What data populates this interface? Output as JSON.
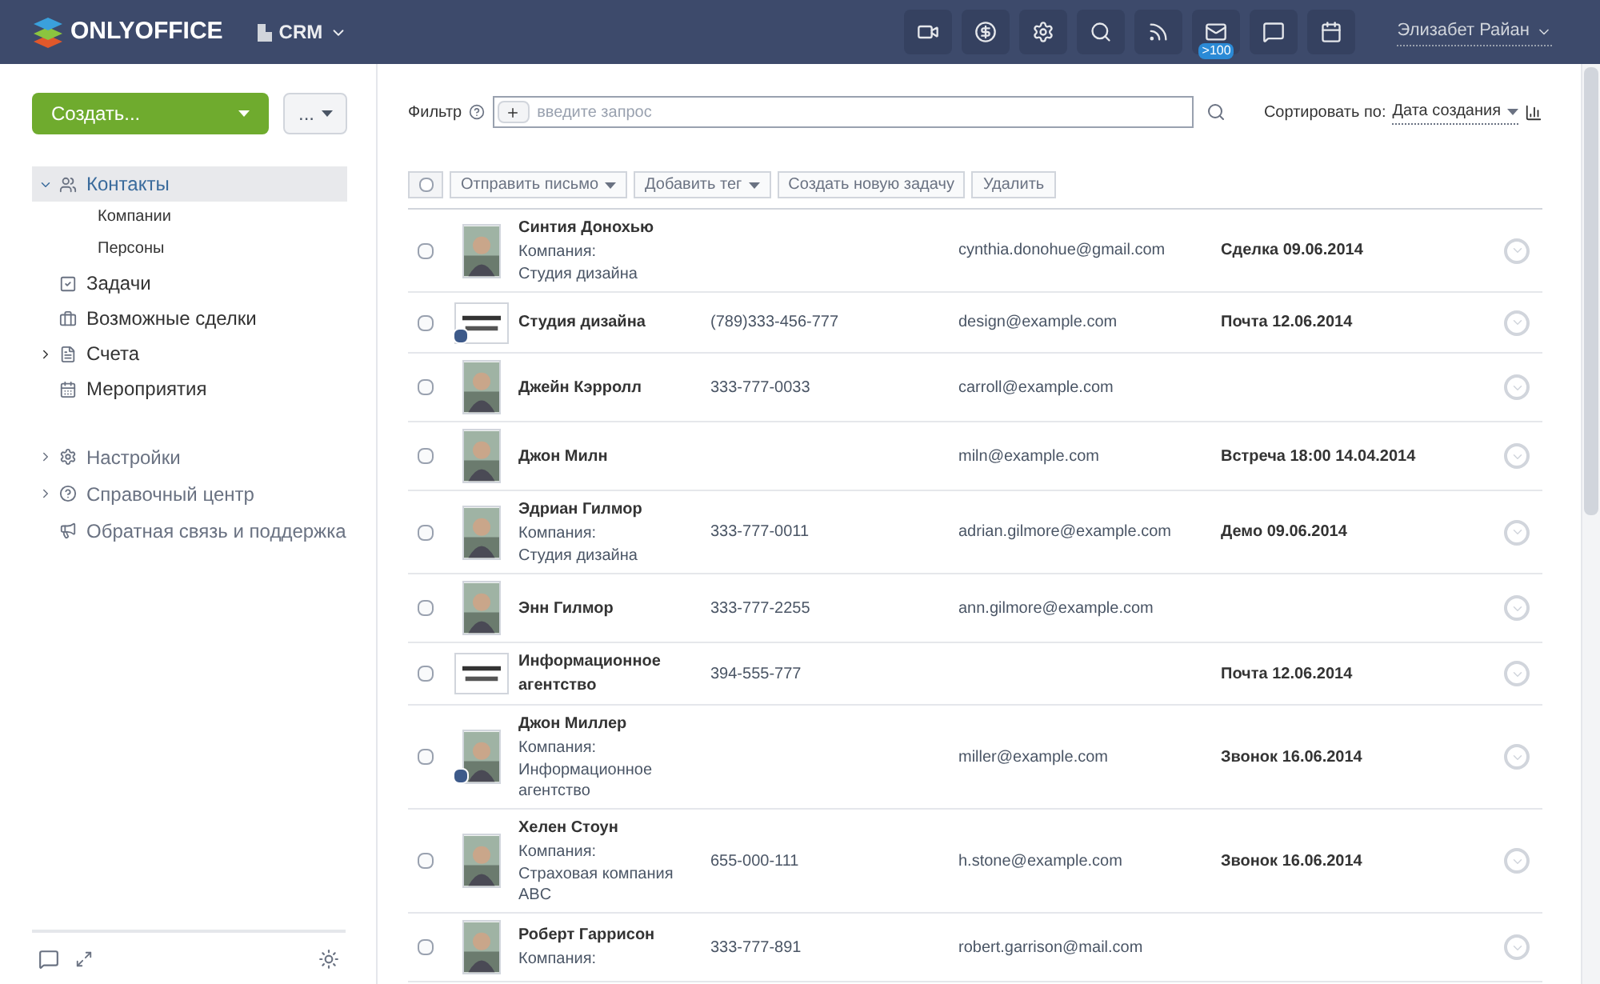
{
  "header": {
    "logo": "ONLYOFFICE",
    "module": "CRM",
    "mail_badge": ">100",
    "user": "Элизабет Райан"
  },
  "sidebar": {
    "create_button": "Создать...",
    "more_button": "...",
    "nav": [
      {
        "label": "Контакты",
        "selected": true,
        "expanded": true,
        "children": [
          {
            "label": "Компании"
          },
          {
            "label": "Персоны"
          }
        ]
      },
      {
        "label": "Задачи",
        "selected": false
      },
      {
        "label": "Возможные сделки",
        "selected": false
      },
      {
        "label": "Счета",
        "selected": false,
        "expanded": false
      },
      {
        "label": "Мероприятия",
        "selected": false
      }
    ],
    "extra": [
      {
        "label": "Настройки",
        "expanded": false
      },
      {
        "label": "Справочный центр",
        "expanded": false
      },
      {
        "label": "Обратная связь и поддержка"
      }
    ]
  },
  "filter": {
    "label": "Фильтр",
    "placeholder": "введите запрос",
    "sort_label": "Сортировать по:",
    "sort_value": "Дата создания"
  },
  "actions": {
    "select_all": {
      "checked": false
    },
    "buttons": [
      {
        "label": "Отправить письмо",
        "dropdown": true
      },
      {
        "label": "Добавить тег",
        "dropdown": true
      },
      {
        "label": "Создать новую задачу",
        "dropdown": false
      },
      {
        "label": "Удалить",
        "dropdown": false
      }
    ]
  },
  "contacts": [
    {
      "kind": "person",
      "name": "Синтия Донохью",
      "company_label": "Компания:",
      "company": "Студия дизайна",
      "email": "cynthia.donohue@gmail.com",
      "event": "Сделка 09.06.2014",
      "checked": false,
      "edit_badge": false
    },
    {
      "kind": "company",
      "name": "Студия дизайна",
      "phone": "(789)333-456-777",
      "email": "design@example.com",
      "event": "Почта 12.06.2014",
      "checked": false,
      "edit_badge": true
    },
    {
      "kind": "person",
      "name": "Джейн Кэрролл",
      "phone": "333-777-0033",
      "email": "carroll@example.com",
      "checked": false,
      "edit_badge": false
    },
    {
      "kind": "person",
      "name": "Джон Милн",
      "email": "miln@example.com",
      "event": "Встреча 18:00 14.04.2014",
      "checked": false,
      "edit_badge": false
    },
    {
      "kind": "person",
      "name": "Эдриан Гилмор",
      "company_label": "Компания:",
      "company": "Студия дизайна",
      "phone": "333-777-0011",
      "email": "adrian.gilmore@example.com",
      "event": "Демо 09.06.2014",
      "checked": false,
      "edit_badge": false
    },
    {
      "kind": "person",
      "name": "Энн Гилмор",
      "phone": "333-777-2255",
      "email": "ann.gilmore@example.com",
      "checked": false,
      "edit_badge": false
    },
    {
      "kind": "company",
      "name": "Информационное агентство",
      "phone": "394-555-777",
      "event": "Почта 12.06.2014",
      "checked": false,
      "edit_badge": false
    },
    {
      "kind": "person",
      "name": "Джон Миллер",
      "company_label": "Компания:",
      "company": "Информационное агентство",
      "email": "miller@example.com",
      "event": "Звонок 16.06.2014",
      "checked": false,
      "edit_badge": true
    },
    {
      "kind": "person",
      "name": "Хелен Стоун",
      "company_label": "Компания:",
      "company": "Страховая компания ABC",
      "phone": "655-000-111",
      "email": "h.stone@example.com",
      "event": "Звонок 16.06.2014",
      "checked": false,
      "edit_badge": false
    },
    {
      "kind": "person",
      "name": "Роберт Гаррисон",
      "company_label": "Компания:",
      "phone": "333-777-891",
      "email": "robert.garrison@mail.com",
      "checked": false,
      "edit_badge": false
    }
  ]
}
